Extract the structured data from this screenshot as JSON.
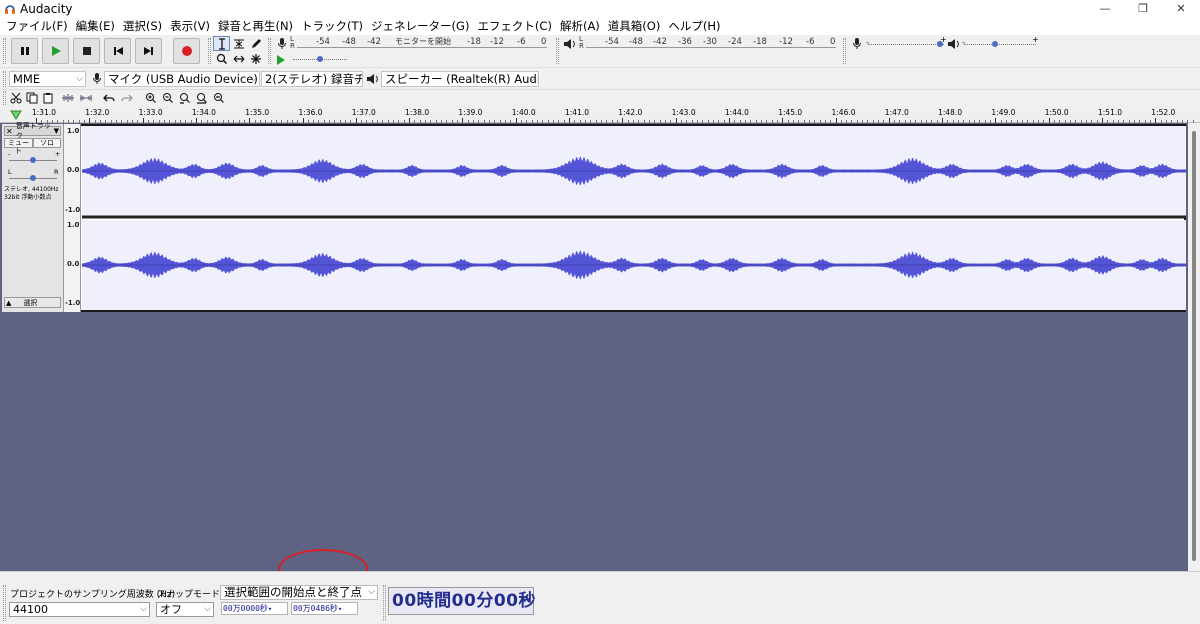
{
  "window": {
    "title": "Audacity"
  },
  "menu": [
    "ファイル(F)",
    "編集(E)",
    "選択(S)",
    "表示(V)",
    "録音と再生(N)",
    "トラック(T)",
    "ジェネレーター(G)",
    "エフェクト(C)",
    "解析(A)",
    "道具箱(O)",
    "ヘルプ(H)"
  ],
  "meters": {
    "rec_scale": [
      "L",
      "R",
      "-54",
      "-48",
      "-42",
      "モニターを開始",
      "-18",
      "-12",
      "-6",
      "0"
    ],
    "play_scale": [
      "-54",
      "-48",
      "-42",
      "-36",
      "-30",
      "-24",
      "-18",
      "-12",
      "-6",
      "0"
    ],
    "rec_ticks": [
      "-54",
      "-48",
      "-42",
      "-18",
      "-12",
      "-6",
      "0"
    ],
    "rec_monitor": "モニターを開始",
    "lr": [
      "L",
      "R"
    ]
  },
  "device": {
    "host": "MME",
    "input": "マイク (USB Audio Device)",
    "channels": "2(ステレオ) 録音チ",
    "output": "スピーカー (Realtek(R) Audio)"
  },
  "ruler": {
    "labels": [
      "1:31.0",
      "1:32.0",
      "1:33.0",
      "1:34.0",
      "1:35.0",
      "1:36.0",
      "1:37.0",
      "1:38.0",
      "1:39.0",
      "1:40.0",
      "1:41.0",
      "1:42.0",
      "1:43.0",
      "1:44.0",
      "1:45.0",
      "1:46.0",
      "1:47.0",
      "1:48.0",
      "1:49.0",
      "1:50.0",
      "1:51.0",
      "1:52.0"
    ]
  },
  "track": {
    "name": "音声トラック",
    "mute": "ミュート",
    "solo": "ソロ",
    "minus": "-",
    "plus": "+",
    "left": "L",
    "right": "R",
    "info1": "ステレオ, 44100Hz",
    "info2": "32bit 浮動小数点",
    "select": "選択",
    "vlabels": [
      "1.0",
      "0.0",
      "-1.0"
    ]
  },
  "bottom": {
    "rate_label": "プロジェクトのサンプリング周波数 (Hz)",
    "rate_value": "44100",
    "snap_label": "スナップモード",
    "snap_value": "オフ",
    "selection_label": "選択範囲の開始点と終了点",
    "start_time": "00万0000秒",
    "end_time": "00万0486秒",
    "big_time": "00時間00分00秒"
  },
  "colors": {
    "waveform": "#5454d6",
    "track_bg": "#5f6383",
    "annotation": "#d61f26"
  }
}
